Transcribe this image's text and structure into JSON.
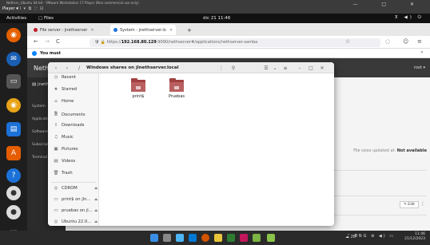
{
  "vm": {
    "title": "Nethsrv_Ubuntu 64-bit - VMware Workstation 17 Player (Non-commercial use only)",
    "menu": "Player ▾",
    "controls": "II ▾ ⧉ ⛶ ⊡",
    "window_buttons": "— □ ✕"
  },
  "gnome": {
    "activities": "Activities",
    "app": "Files",
    "clock": "dic 21  11:46",
    "tray": "⊼ ◀) ⏻"
  },
  "dock": {
    "items": [
      "firefox-icon",
      "thunderbird-icon",
      "terminal-icon",
      "rhythmbox-icon",
      "writer-icon",
      "software-icon",
      "help-icon",
      "disc-icon",
      "disc-icon",
      "apps-grid-icon"
    ]
  },
  "firefox": {
    "tabs": [
      {
        "label": "File server - jnethserver",
        "close": "✕"
      },
      {
        "label": "System - jnethserver.lo",
        "close": "✕"
      }
    ],
    "new_tab": "+",
    "url_prefix": "https://",
    "url_host": "192.168.80.129",
    "url_rest": ":9090/nethserver#/applications/nethserver-samba",
    "notice": "You must",
    "back": "←",
    "forward": "→",
    "reload": "C",
    "bookmark": "☆",
    "menu": "≡"
  },
  "nethserver": {
    "logo": "NethSer",
    "user": "root ▾",
    "breadcrumb": "jnethser",
    "side_items": [
      "System",
      "Applications",
      "Software Center",
      "Subscription",
      "Terminal"
    ],
    "status_prefix": "File sizes updated at:",
    "status_value": "Not available",
    "edit_label": "✎ Edit",
    "kebab": "⋮"
  },
  "nautilus": {
    "path": "Windows shares on jlnethserver.local",
    "path_sep": "/",
    "sidebar": [
      {
        "icon": "◷",
        "label": "Recent"
      },
      {
        "icon": "★",
        "label": "Starred"
      },
      {
        "icon": "⌂",
        "label": "Home"
      },
      {
        "icon": "🗎",
        "label": "Documents"
      },
      {
        "icon": "⇩",
        "label": "Downloads"
      },
      {
        "icon": "♫",
        "label": "Music"
      },
      {
        "icon": "▣",
        "label": "Pictures"
      },
      {
        "icon": "▤",
        "label": "Videos"
      },
      {
        "icon": "🗑",
        "label": "Trash"
      }
    ],
    "devices": [
      {
        "icon": "◎",
        "label": "CDROM",
        "eject": "⏏"
      },
      {
        "icon": "▭",
        "label": "print$ on jln...",
        "eject": "⏏"
      },
      {
        "icon": "▭",
        "label": "pruebas on jl...",
        "eject": "⏏"
      },
      {
        "icon": "◎",
        "label": "Ubuntu 22.0...",
        "eject": "⏏"
      }
    ],
    "shares": [
      "print$",
      "Pruebas"
    ],
    "header_buttons": {
      "back": "‹",
      "forward": "›",
      "more": "⋮",
      "search": "⚲",
      "view_list": "☰",
      "view_toggle": "⌄",
      "sort": "≡",
      "minimize": "–",
      "maximize": "□",
      "close": "✕"
    }
  },
  "taskbar": {
    "weather": "☁ 26°",
    "tray": "⌃ ENG ⊛ ◀) ▭",
    "time": "11:46",
    "date": "21/12/2023"
  }
}
